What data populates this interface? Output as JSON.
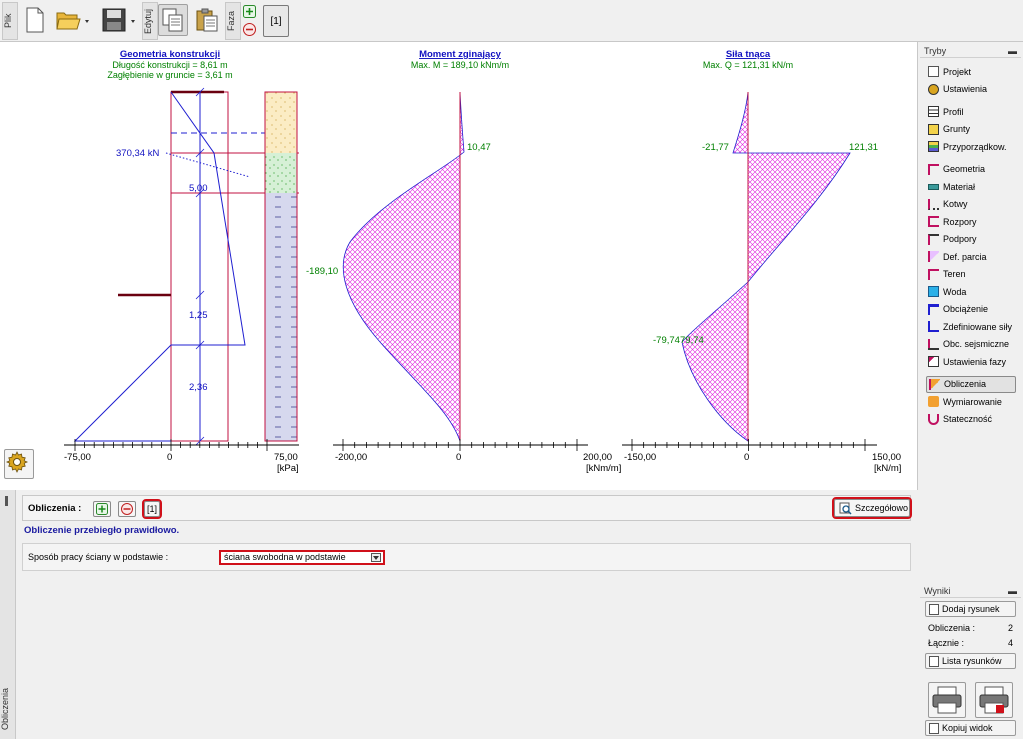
{
  "toolbar": {
    "file_tab": "Plik",
    "edit_tab": "Edytuj",
    "phase_tab": "Faza",
    "phase_value": "[1]"
  },
  "charts": {
    "geometry": {
      "title": "Geometria konstrukcji",
      "line1": "Długość konstrukcji = 8,61 m",
      "line2": "Zagłębienie w gruncie = 3,61 m",
      "anchor_force": "370,34 kN",
      "dim1": "5,00",
      "dim2": "1,25",
      "dim3": "2,36",
      "tick_left": "-75,00",
      "tick_zero": "0",
      "tick_right": "75,00",
      "unit": "[kPa]"
    },
    "moment": {
      "title": "Moment zginający",
      "subtitle": "Max. M = 189,10 kNm/m",
      "label_top": "10,47",
      "label_min": "-189,10",
      "tick_left": "-200,00",
      "tick_zero": "0",
      "tick_right": "200,00",
      "unit": "[kNm/m]"
    },
    "shear": {
      "title": "Siła tnąca",
      "subtitle": "Max. Q = 121,31 kN/m",
      "label_neg": "-21,77",
      "label_pos": "121,31",
      "label_low": "-79,74",
      "label_low2": "79,74",
      "tick_left": "-150,00",
      "tick_zero": "0",
      "tick_right": "150,00",
      "unit": "[kN/m]"
    }
  },
  "sidebar": {
    "title": "Tryby",
    "items": [
      {
        "label": "Projekt"
      },
      {
        "label": "Ustawienia"
      },
      {
        "label": "Profil"
      },
      {
        "label": "Grunty"
      },
      {
        "label": "Przyporządkow."
      },
      {
        "label": "Geometria"
      },
      {
        "label": "Materiał"
      },
      {
        "label": "Kotwy"
      },
      {
        "label": "Rozpory"
      },
      {
        "label": "Podpory"
      },
      {
        "label": "Def. parcia"
      },
      {
        "label": "Teren"
      },
      {
        "label": "Woda"
      },
      {
        "label": "Obciążenie"
      },
      {
        "label": "Zdefiniowane siły"
      },
      {
        "label": "Obc. sejsmiczne"
      },
      {
        "label": "Ustawienia fazy"
      },
      {
        "label": "Obliczenia"
      },
      {
        "label": "Wymiarowanie"
      },
      {
        "label": "Stateczność"
      }
    ]
  },
  "results": {
    "title": "Wyniki",
    "add_drawing": "Dodaj rysunek",
    "calc_label": "Obliczenia :",
    "calc_value": "2",
    "total_label": "Łącznie :",
    "total_value": "4",
    "list_drawings": "Lista rysunków",
    "copy_view": "Kopiuj widok"
  },
  "bottom": {
    "side_tab": "Obliczenia",
    "calc_label": "Obliczenia :",
    "calc_index": "[1]",
    "details_button": "Szczegółowo",
    "status": "Obliczenie przebiegło prawidłowo.",
    "option_label": "Sposób pracy ściany w podstawie :",
    "option_value": "ściana swobodna w podstawie"
  },
  "colors": {
    "accent_red": "#d0101a",
    "chart_blue": "#1f1fd0",
    "chart_magenta": "#e020e0",
    "label_green": "#008000"
  }
}
